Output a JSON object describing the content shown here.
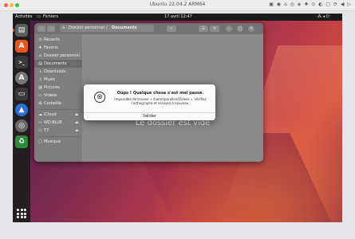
{
  "host": {
    "title": "Ubuntu 22.04.2 ARM64",
    "status_icons": "▣ ◉ ⌂ ◎ ◈ ✚ ⊙ ◐ ▢ ⟳ ◀ ▷",
    "colors": {
      "close": "#fe5f57",
      "minimize": "#febc2e",
      "maximize": "#28c840"
    }
  },
  "topbar": {
    "activities": "Activités",
    "app_name": "Fichiers",
    "clock": "17 avril  12:47",
    "system_icons": "⁂ ◂ ⏻"
  },
  "dock": {
    "items": [
      {
        "name": "Files",
        "icon": "▤",
        "color": "#5d5d5d"
      },
      {
        "name": "Ubuntu Software",
        "icon": "A",
        "color": "#e95420"
      },
      {
        "name": "Terminal",
        "icon": ">_",
        "color": "#3a3a3a"
      },
      {
        "name": "Software",
        "icon": "A",
        "color": "#777777"
      },
      {
        "name": "Screenshot",
        "icon": "▭",
        "color": "#3a3a3a"
      },
      {
        "name": "Software Updater",
        "icon": "▲",
        "color": "#2a6fd6"
      },
      {
        "name": "Disks",
        "icon": "◎",
        "color": "#6a6a6a"
      },
      {
        "name": "Trash",
        "icon": "♻",
        "color": "#2d8a3a"
      }
    ],
    "apps_label": "Afficher les applications",
    "active_color": "#e95420"
  },
  "files": {
    "back_icon": "‹",
    "forward_icon": "›",
    "home_icon": "⌂",
    "breadcrumb_home": "Dossier personnel",
    "breadcrumb_sep": "/",
    "breadcrumb_current": "Documents",
    "search_icon": "⌕",
    "view_icon": "☰",
    "menu_icon": "≡",
    "minimize_icon": "–",
    "maximize_icon": "□",
    "close_icon": "×",
    "empty_text": "Le dossier est vide",
    "sidebar": [
      {
        "icon": "◷",
        "label": "Récents"
      },
      {
        "icon": "★",
        "label": "Favoris"
      },
      {
        "icon": "⌂",
        "label": "Dossier personnel"
      },
      {
        "icon": "▤",
        "label": "Documents"
      },
      {
        "icon": "↓",
        "label": "Downloads"
      },
      {
        "icon": "♫",
        "label": "Music"
      },
      {
        "icon": "▨",
        "label": "Pictures"
      },
      {
        "icon": "▭",
        "label": "Videos"
      },
      {
        "icon": "♻",
        "label": "Corbeille"
      },
      {
        "icon": "☁",
        "label": "iCloud",
        "eject": "⏏"
      },
      {
        "icon": "▭",
        "label": "WD-BLUE",
        "eject": "⏏"
      },
      {
        "icon": "▭",
        "label": "T7",
        "eject": "⏏"
      },
      {
        "icon": "▢",
        "label": "Musique"
      }
    ]
  },
  "dialog": {
    "icon": "⊗",
    "title": "Oups ! Quelque chose s'est mal passé.",
    "message": "Impossible de trouver « /home/parallels/Videos ». Vérifiez l'orthographe et essayez à nouveau.",
    "button": "Valider"
  }
}
